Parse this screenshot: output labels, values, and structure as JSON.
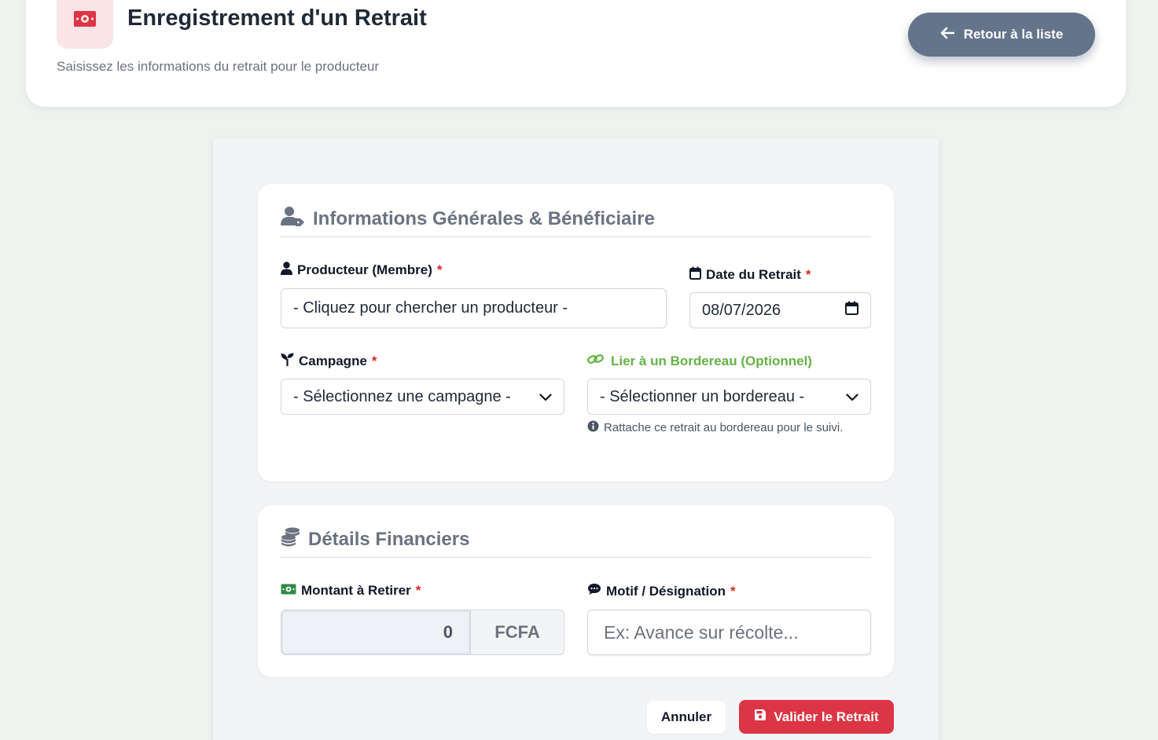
{
  "header": {
    "title": "Enregistrement d'un Retrait",
    "subtitle": "Saisissez les informations du retrait pour le producteur",
    "back_label": "Retour à la liste",
    "icon": "money-bill-icon"
  },
  "colors": {
    "accent_red": "#dc3545",
    "back_button": "#64748b",
    "link_green": "#65b245",
    "page_bg": "#eff3ef"
  },
  "general_section": {
    "title": "Informations Générales & Bénéficiaire",
    "producer": {
      "label": "Producteur (Membre)",
      "required": "*",
      "value": "- Cliquez pour chercher un producteur -"
    },
    "date": {
      "label": "Date du Retrait",
      "required": "*",
      "value": "08/07/2026"
    },
    "campaign": {
      "label": "Campagne",
      "required": "*",
      "selected": "- Sélectionnez une campagne -"
    },
    "bordereau": {
      "label": "Lier à un Bordereau (Optionnel)",
      "selected": "- Sélectionner un bordereau -",
      "help": "Rattache ce retrait au bordereau pour le suivi."
    }
  },
  "finance_section": {
    "title": "Détails Financiers",
    "amount": {
      "label": "Montant à Retirer",
      "required": "*",
      "value": "0",
      "unit": "FCFA"
    },
    "motif": {
      "label": "Motif / Désignation",
      "required": "*",
      "placeholder": "Ex: Avance sur récolte..."
    }
  },
  "actions": {
    "cancel_label": "Annuler",
    "submit_label": "Valider le Retrait"
  }
}
